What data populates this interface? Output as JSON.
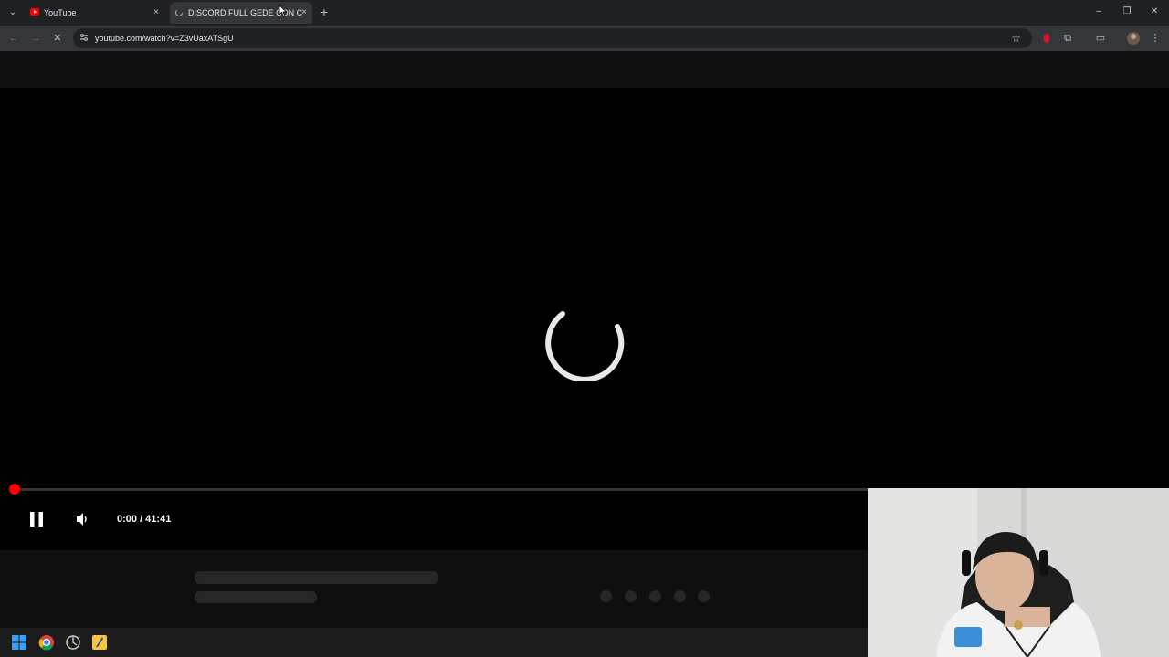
{
  "tabs": [
    {
      "title": "YouTube",
      "favicon": "youtube-icon",
      "close": "×"
    },
    {
      "title": "DISCORD FULL GEDE CON C",
      "favicon": "loading-icon",
      "close": "×"
    }
  ],
  "tab_menu_symbol": "⌄",
  "new_tab_symbol": "+",
  "window_controls": {
    "minimize": "–",
    "restore": "❐",
    "close": "✕"
  },
  "nav": {
    "back": "←",
    "forward": "→",
    "stop": "✕"
  },
  "omnibox": {
    "url": "youtube.com/watch?v=Z3vUaxATSgU",
    "star": "☆"
  },
  "toolbar_icons": {
    "extensions": "⧉",
    "cast": "▭",
    "menu": "⋮"
  },
  "player": {
    "time": "0:00 / 41:41",
    "progress": 0,
    "state": "loading"
  },
  "colors": {
    "accent": "#ff0000",
    "tab_active": "#35363a",
    "background": "#000000"
  }
}
